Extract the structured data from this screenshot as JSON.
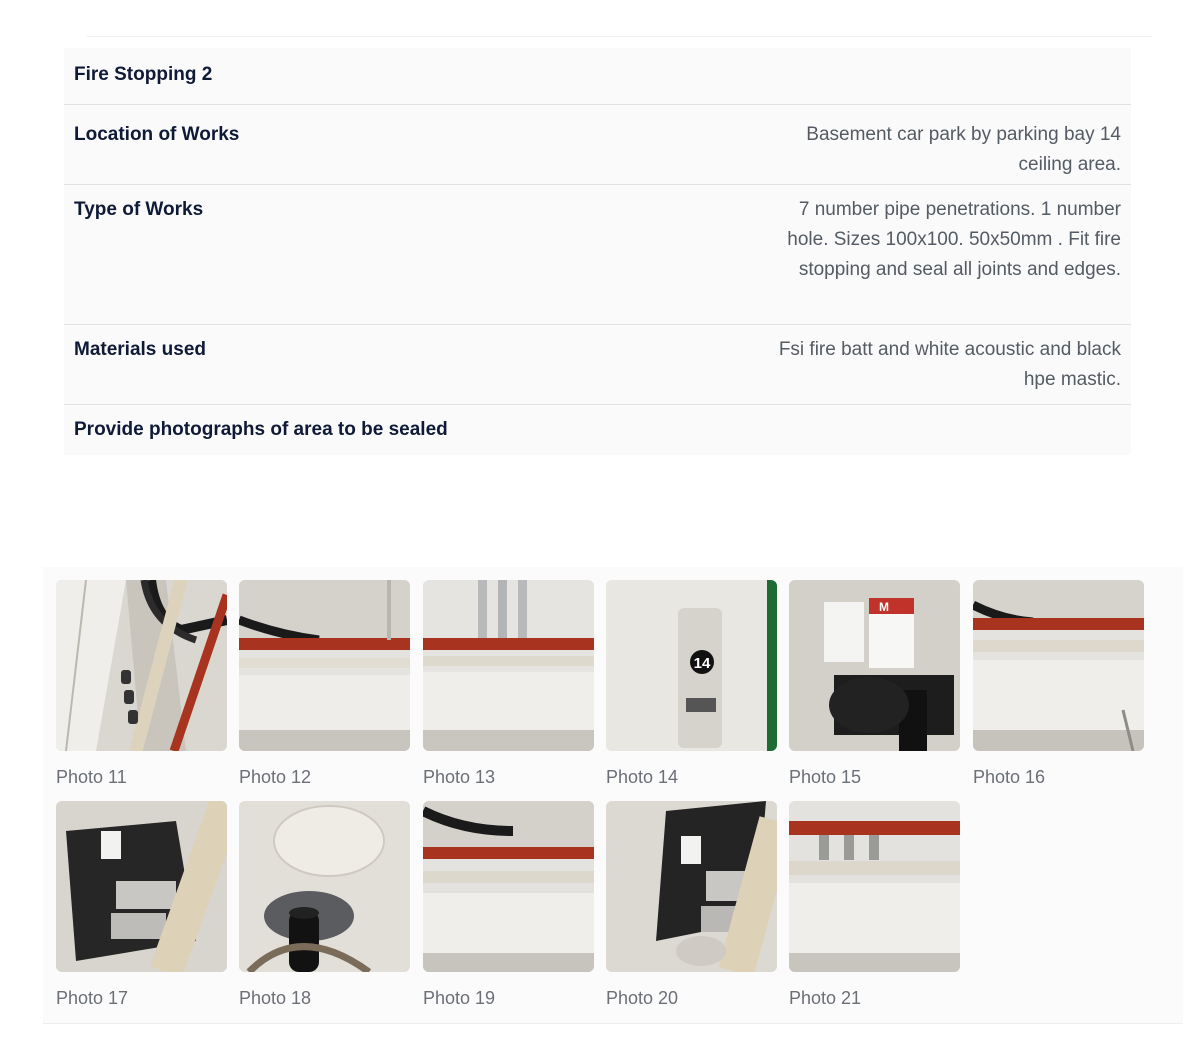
{
  "section": {
    "title": "Fire Stopping 2",
    "rows": [
      {
        "label": "Location of Works",
        "value": "Basement car park by parking bay 14 ceiling area."
      },
      {
        "label": "Type of Works",
        "value": "7 number pipe penetrations. 1 number hole. Sizes 100x100. 50x50mm . Fit fire stopping and seal all joints and edges."
      },
      {
        "label": "Materials used",
        "value": "Fsi fire batt and white acoustic and black hpe mastic."
      },
      {
        "label": "Provide photographs of area to be sealed",
        "value": ""
      }
    ]
  },
  "photos": [
    {
      "caption": "Photo 11"
    },
    {
      "caption": "Photo 12"
    },
    {
      "caption": "Photo 13"
    },
    {
      "caption": "Photo 14"
    },
    {
      "caption": "Photo 15"
    },
    {
      "caption": "Photo 16"
    },
    {
      "caption": "Photo 17"
    },
    {
      "caption": "Photo 18"
    },
    {
      "caption": "Photo 19"
    },
    {
      "caption": "Photo 20"
    },
    {
      "caption": "Photo 21"
    }
  ],
  "photo_14_sign": "14",
  "photo_15_label": "M",
  "colors": {
    "heading": "#0f1a36",
    "value_text": "#555b63",
    "caption": "#6b6f76",
    "card_bg": "#fafafb",
    "divider": "#dfe1e5",
    "red_pipe": "#a8341f",
    "mastic": "#222222"
  }
}
